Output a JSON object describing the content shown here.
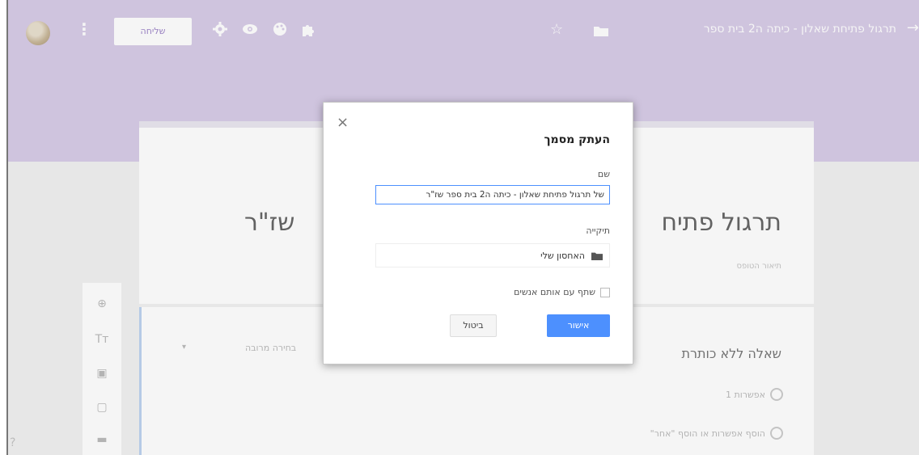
{
  "header": {
    "doc_title": "תרגול פתיחת שאלון - כיתה ה2 בית ספר",
    "send_label": "שליחה",
    "icons": [
      "more-icon",
      "gear-icon",
      "eye-icon",
      "palette-icon",
      "puzzle-icon",
      "star-icon",
      "folder-icon",
      "back-arrow-icon"
    ]
  },
  "form": {
    "title_right": "תרגול פתיח",
    "title_left": "שז\"ר",
    "description": "תיאור הטופס",
    "question": {
      "title": "שאלה ללא כותרת",
      "type": "בחירה מרובה",
      "option1": "אפשרות 1",
      "option2": "הוסף אפשרות או הוסף \"אחר\""
    }
  },
  "dialog": {
    "title": "העתק מסמך",
    "name_label": "שם",
    "name_value": "של תרגול פתיחת שאלון - כיתה ה2 בית ספר שז\"ר",
    "folder_label": "תיקייה",
    "folder_value": "האחסון שלי",
    "share_label": "שתף עם אותם אנשים",
    "ok_label": "אישור",
    "cancel_label": "ביטול"
  },
  "colors": {
    "header_bg": "#d8cce8",
    "accent_blue": "#4d90fe"
  }
}
